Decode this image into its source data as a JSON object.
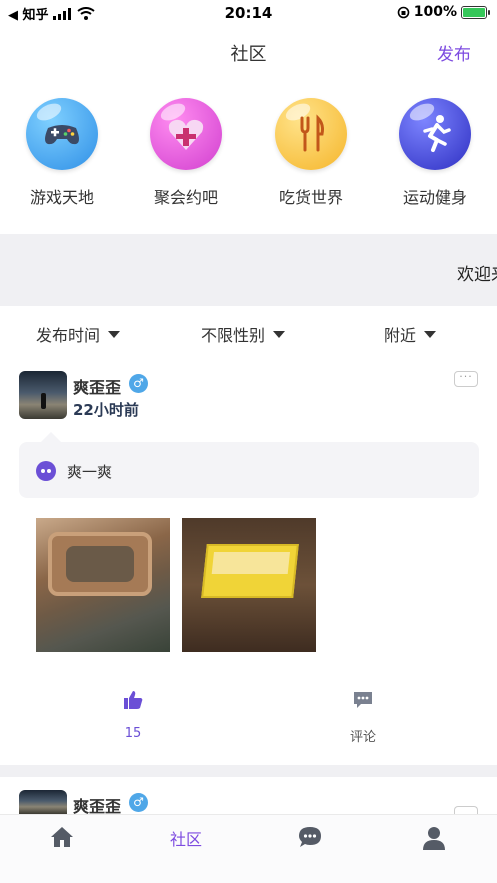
{
  "status_bar": {
    "back_app": "◀ 知乎",
    "time": "20:14",
    "battery": "100%",
    "battery_level": 1.0
  },
  "nav": {
    "title": "社区",
    "action": "发布"
  },
  "categories": [
    {
      "label": "游戏天地",
      "icon": "gamepad-icon",
      "color": "#3aa3ef"
    },
    {
      "label": "聚会约吧",
      "icon": "heart-gift-icon",
      "color": "#e04bd6"
    },
    {
      "label": "吃货世界",
      "icon": "fork-knife-icon",
      "color": "#f7c43c"
    },
    {
      "label": "运动健身",
      "icon": "runner-icon",
      "color": "#4a4fe0"
    }
  ],
  "banner": {
    "text": "欢迎来"
  },
  "filters": [
    {
      "label": "发布时间"
    },
    {
      "label": "不限性别"
    },
    {
      "label": "附近"
    }
  ],
  "posts": [
    {
      "username": "爽歪歪",
      "gender": "♂",
      "time": "22小时前",
      "topic": "爽一爽",
      "likes": "15",
      "comment_label": "评论"
    },
    {
      "username": "爽歪歪",
      "gender": "♂"
    }
  ],
  "more_glyph": "···",
  "tabs": [
    {
      "name": "home",
      "icon": "home-icon"
    },
    {
      "name": "community",
      "label": "社区",
      "active": true
    },
    {
      "name": "messages",
      "icon": "chat-bubble-icon"
    },
    {
      "name": "profile",
      "icon": "person-icon"
    }
  ],
  "colors": {
    "accent": "#7d4be0",
    "banner_bg": "#f0f0f3",
    "gender_male": "#4fa7e8"
  }
}
